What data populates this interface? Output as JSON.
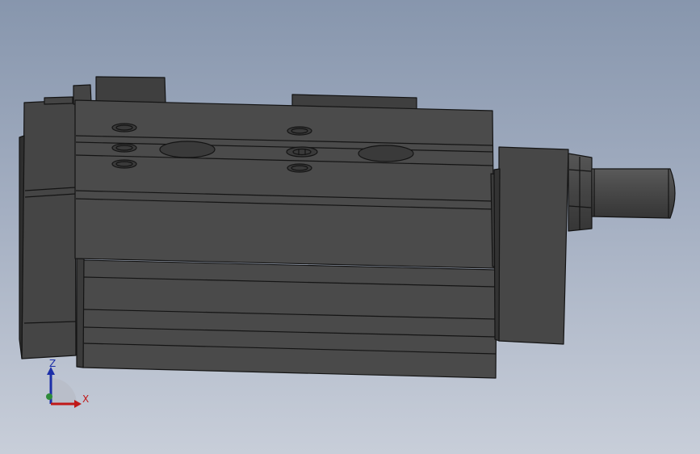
{
  "viewport": {
    "background_top": "#8796ad",
    "background_bottom": "#c8ced9"
  },
  "model": {
    "body_color": "#4a4a4a",
    "edge_color": "#141414"
  },
  "triad": {
    "z_label": "Z",
    "x_label": "X",
    "z_color": "#1c2fa8",
    "x_color": "#c01818",
    "origin_color": "#2e8b3a"
  }
}
